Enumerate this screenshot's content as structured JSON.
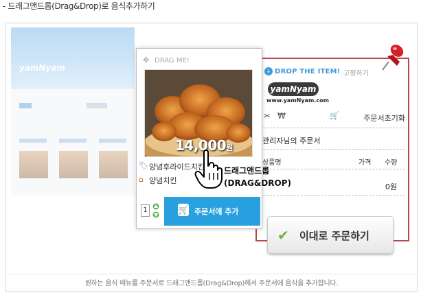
{
  "page_title": "- 드래그앤드롭(Drag&Drop)로 음식추가하기",
  "caption": "원하는 음식 메뉴를 주문서로 드래그앤드롭(Drag&Drop)해서 주문서에 음식을 추가합니다.",
  "background_site": {
    "logo": "yamNyam"
  },
  "drag_card": {
    "drag_label": "DRAG ME!",
    "price": "14,000",
    "price_unit": "원",
    "item_name": "양념후라이드치킨",
    "store_name": "양념치킨",
    "quantity": "1",
    "add_button": "주문서에 추가"
  },
  "cursor_label": {
    "line1": "드래그앤드롭",
    "line2": "(DRAG&DROP)"
  },
  "order_sheet": {
    "drop_label": "DROP THE ITEM!",
    "pin_label": "고정하기",
    "brand": "yamNyam",
    "brand_url": "www.yamNyam.com",
    "reset_label": "주문서초기화",
    "title": "관리자님의 주문서",
    "columns": [
      "상품명",
      "가격",
      "수량"
    ],
    "total": "0원"
  },
  "order_button": "이대로 주문하기",
  "colors": {
    "accent_blue": "#29a0e0",
    "border_red": "#b8464a",
    "check_green": "#6bb33a"
  },
  "icons": [
    "drag-move-icon",
    "drop-icon",
    "tag-icon",
    "house-icon",
    "cart-icon",
    "checkmark-icon",
    "push-pin-icon",
    "hand-cursor-icon"
  ]
}
